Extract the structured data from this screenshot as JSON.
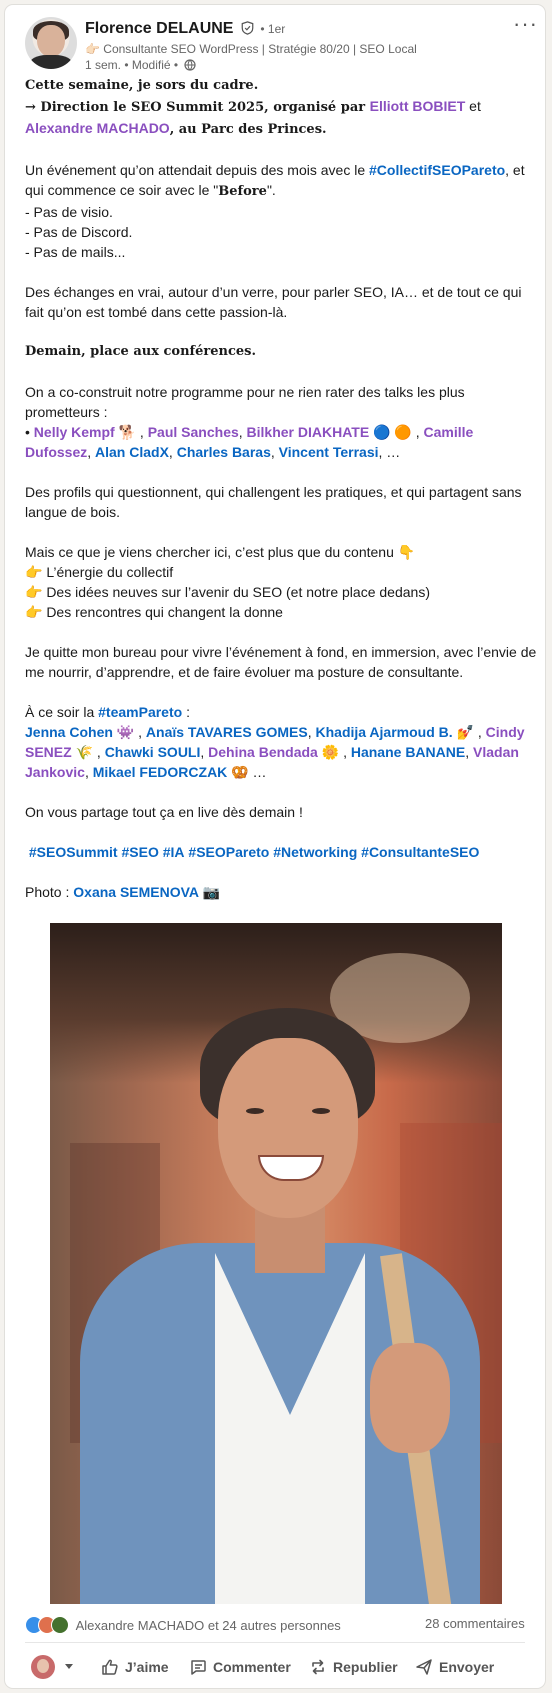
{
  "author": {
    "name": "Florence DELAUNE",
    "degree": "• 1er",
    "headline": "👉🏻 Consultante SEO WordPress | Stratégie 80/20 | SEO Local",
    "meta": "1 sem. • Modifié •"
  },
  "post": {
    "l1": "Cette semaine, je sors du cadre.",
    "l2a": "→ Direction le SEO Summit 2025, organisé par ",
    "l2_mention1": "Elliott BOBIET",
    "l2_and": " et ",
    "l2_mention2": "Alexandre MACHADO",
    "l2b": ", au Parc des Princes.",
    "p2a": "Un événement qu’on attendait depuis des mois avec le ",
    "p2_hashtag": "#CollectifSEOPareto",
    "p2b": ", et qui commence ce soir avec le \"",
    "p2_before": "Before",
    "p2c": "\".",
    "list1": "- Pas de visio.",
    "list2": "- Pas de Discord.",
    "list3": "- Pas de mails...",
    "p3": "Des échanges en vrai, autour d’un verre, pour parler SEO, IA… et de tout ce qui fait qu’on est tombé dans cette passion-là.",
    "p4": "Demain, place aux conférences.",
    "p5": "On a co-construit notre programme pour ne rien rater des talks les plus prometteurs :",
    "speakers_prefix": "• ",
    "sp1": "Nelly Kempf",
    "sp1_emoji": " 🐕 , ",
    "sp2": "Paul Sanches",
    "sp_sep1": ", ",
    "sp3": "Bilkher DIAKHATE",
    "sp3_emoji": " 🔵 🟠 , ",
    "sp4": "Camille Dufossez",
    "sp_sep2": ", ",
    "sp5": "Alan CladX",
    "sp_sep3": ", ",
    "sp6": "Charles Baras",
    "sp_sep4": ", ",
    "sp7": "Vincent Terrasi",
    "sp_end": ", …",
    "p6": "Des profils qui questionnent, qui challengent les pratiques, et qui partagent sans langue de bois.",
    "p7": "Mais ce que je viens chercher ici, c’est plus que du contenu 👇",
    "b1": "👉 L’énergie du collectif",
    "b2": "👉 Des idées neuves sur l’avenir du SEO (et notre place dedans)",
    "b3": "👉 Des rencontres qui changent la donne",
    "p8": "Je quitte mon bureau pour vivre l’événement à fond, en immersion, avec l’envie de me nourrir, d’apprendre, et de faire évoluer ma posture de consultante.",
    "team_prefix": "À ce soir la ",
    "team_hashtag": "#teamPareto",
    "team_suffix": " :",
    "t1": "Jenna Cohen",
    "t1_emoji": " 👾 , ",
    "t2": "Anaïs TAVARES GOMES",
    "t_sep1": ", ",
    "t3": "Khadija Ajarmoud B.",
    "t3_emoji": " 💅 , ",
    "t4": "Cindy SENEZ",
    "t4_emoji": " 🌾 , ",
    "t5": "Chawki SOULI",
    "t_sep2": ", ",
    "t6": "Dehina Bendada",
    "t6_emoji": " 🌼 , ",
    "t7": "Hanane BANANE",
    "t_sep3": ", ",
    "t8": "Vladan Jankovic",
    "t_sep4": ", ",
    "t9": "Mikael FEDORCZAK",
    "t9_emoji": " 🥨 …",
    "p9": "On vous partage tout ça en live dès demain !",
    "hashtags": [
      "#SEOSummit",
      "#SEO",
      "#IA",
      "#SEOPareto",
      "#Networking",
      "#ConsultanteSEO"
    ],
    "photo_prefix": "Photo : ",
    "photo_credit": "Oxana SEMENOVA",
    "photo_emoji": " 📷"
  },
  "social": {
    "reactions_text": "Alexandre MACHADO et 24 autres personnes",
    "comments": "28 commentaires"
  },
  "actions": {
    "like": "J’aime",
    "comment": "Commenter",
    "repost": "Republier",
    "send": "Envoyer"
  },
  "colors": {
    "link": "#0a66c2",
    "mention": "#8a4fbf",
    "background": "#f4f2ee"
  }
}
